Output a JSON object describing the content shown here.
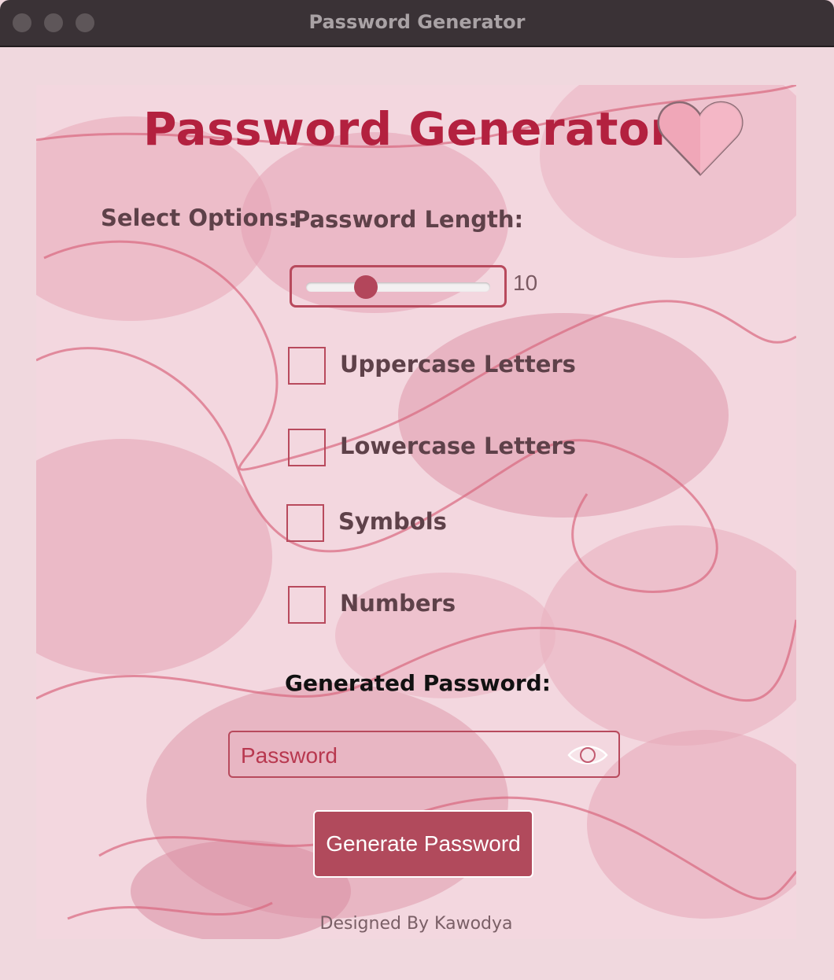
{
  "window": {
    "title": "Password Generator"
  },
  "app": {
    "title": "Password Generator",
    "select_options_label": "Select Options:",
    "password_length_label": "Password Length:",
    "slider": {
      "value": "10",
      "min": 1,
      "max": 50,
      "fraction": 0.3
    },
    "options": [
      {
        "label": "Uppercase Letters",
        "checked": false
      },
      {
        "label": "Lowercase Letters",
        "checked": false
      },
      {
        "label": "Symbols",
        "checked": false
      },
      {
        "label": "Numbers",
        "checked": false
      }
    ],
    "generated_password_label": "Generated Password:",
    "password_placeholder": "Password",
    "generate_button_label": "Generate Password",
    "footer": "Designed By Kawodya"
  },
  "icons": {
    "heart": "heart-icon",
    "eye": "eye-icon"
  },
  "colors": {
    "accent": "#b14a5c",
    "title": "#b3213f",
    "background": "#f3d7df"
  }
}
